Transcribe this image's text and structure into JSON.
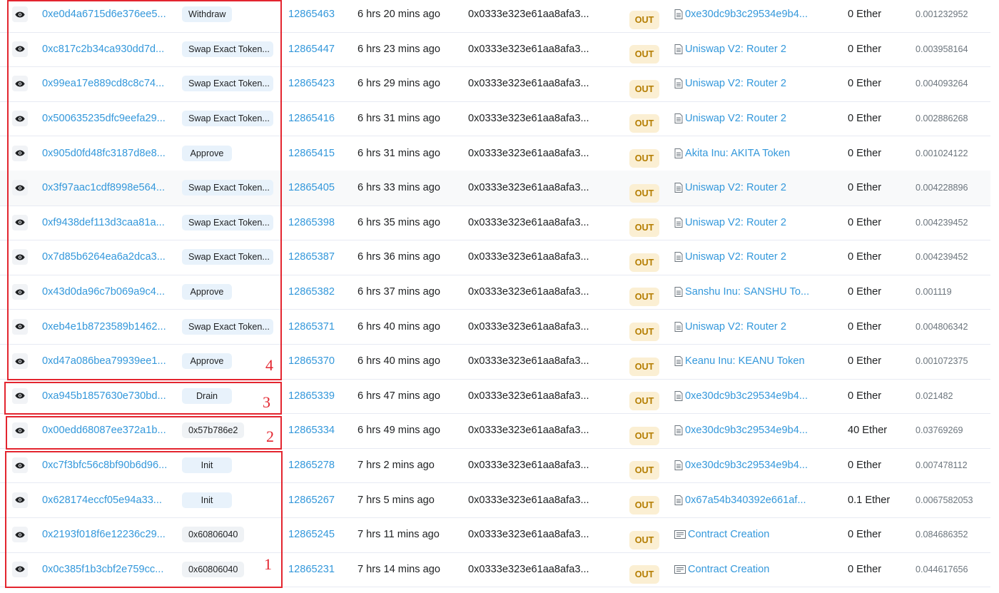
{
  "colors": {
    "link": "#3498db",
    "out_badge_bg": "#fbefd3",
    "out_badge_text": "#b47d00",
    "method_badge_bg": "#e8f2fb",
    "annotation": "#e3252f"
  },
  "icons": {
    "view": "eye-icon",
    "contract": "contract-file-icon",
    "creation": "contract-creation-icon"
  },
  "rows": [
    {
      "hash": "0xe0d4a6715d6e376ee5...",
      "method": "Withdraw",
      "block": "12865463",
      "age": "6 hrs 20 mins ago",
      "from": "0x0333e323e61aa8afa3...",
      "direction": "OUT",
      "to": "0xe30dc9b3c29534e9b4...",
      "value": "0 Ether",
      "fee": "0.001232952",
      "to_icon": "contract-file-icon"
    },
    {
      "hash": "0xc817c2b34ca930dd7d...",
      "method": "Swap Exact Token...",
      "block": "12865447",
      "age": "6 hrs 23 mins ago",
      "from": "0x0333e323e61aa8afa3...",
      "direction": "OUT",
      "to": "Uniswap V2: Router 2",
      "value": "0 Ether",
      "fee": "0.003958164",
      "to_icon": "contract-file-icon"
    },
    {
      "hash": "0x99ea17e889cd8c8c74...",
      "method": "Swap Exact Token...",
      "block": "12865423",
      "age": "6 hrs 29 mins ago",
      "from": "0x0333e323e61aa8afa3...",
      "direction": "OUT",
      "to": "Uniswap V2: Router 2",
      "value": "0 Ether",
      "fee": "0.004093264",
      "to_icon": "contract-file-icon"
    },
    {
      "hash": "0x500635235dfc9eefa29...",
      "method": "Swap Exact Token...",
      "block": "12865416",
      "age": "6 hrs 31 mins ago",
      "from": "0x0333e323e61aa8afa3...",
      "direction": "OUT",
      "to": "Uniswap V2: Router 2",
      "value": "0 Ether",
      "fee": "0.002886268",
      "to_icon": "contract-file-icon"
    },
    {
      "hash": "0x905d0fd48fc3187d8e8...",
      "method": "Approve",
      "block": "12865415",
      "age": "6 hrs 31 mins ago",
      "from": "0x0333e323e61aa8afa3...",
      "direction": "OUT",
      "to": "Akita Inu: AKITA Token",
      "value": "0 Ether",
      "fee": "0.001024122",
      "to_icon": "contract-file-icon"
    },
    {
      "hash": "0x3f97aac1cdf8998e564...",
      "method": "Swap Exact Token...",
      "block": "12865405",
      "age": "6 hrs 33 mins ago",
      "from": "0x0333e323e61aa8afa3...",
      "direction": "OUT",
      "to": "Uniswap V2: Router 2",
      "value": "0 Ether",
      "fee": "0.004228896",
      "to_icon": "contract-file-icon",
      "highlight": true
    },
    {
      "hash": "0xf9438def113d3caa81a...",
      "method": "Swap Exact Token...",
      "block": "12865398",
      "age": "6 hrs 35 mins ago",
      "from": "0x0333e323e61aa8afa3...",
      "direction": "OUT",
      "to": "Uniswap V2: Router 2",
      "value": "0 Ether",
      "fee": "0.004239452",
      "to_icon": "contract-file-icon"
    },
    {
      "hash": "0x7d85b6264ea6a2dca3...",
      "method": "Swap Exact Token...",
      "block": "12865387",
      "age": "6 hrs 36 mins ago",
      "from": "0x0333e323e61aa8afa3...",
      "direction": "OUT",
      "to": "Uniswap V2: Router 2",
      "value": "0 Ether",
      "fee": "0.004239452",
      "to_icon": "contract-file-icon"
    },
    {
      "hash": "0x43d0da96c7b069a9c4...",
      "method": "Approve",
      "block": "12865382",
      "age": "6 hrs 37 mins ago",
      "from": "0x0333e323e61aa8afa3...",
      "direction": "OUT",
      "to": "Sanshu Inu: SANSHU To...",
      "value": "0 Ether",
      "fee": "0.001119",
      "to_icon": "contract-file-icon"
    },
    {
      "hash": "0xeb4e1b8723589b1462...",
      "method": "Swap Exact Token...",
      "block": "12865371",
      "age": "6 hrs 40 mins ago",
      "from": "0x0333e323e61aa8afa3...",
      "direction": "OUT",
      "to": "Uniswap V2: Router 2",
      "value": "0 Ether",
      "fee": "0.004806342",
      "to_icon": "contract-file-icon"
    },
    {
      "hash": "0xd47a086bea79939ee1...",
      "method": "Approve",
      "block": "12865370",
      "age": "6 hrs 40 mins ago",
      "from": "0x0333e323e61aa8afa3...",
      "direction": "OUT",
      "to": "Keanu Inu: KEANU Token",
      "value": "0 Ether",
      "fee": "0.001072375",
      "to_icon": "contract-file-icon"
    },
    {
      "hash": "0xa945b1857630e730bd...",
      "method": "Drain",
      "block": "12865339",
      "age": "6 hrs 47 mins ago",
      "from": "0x0333e323e61aa8afa3...",
      "direction": "OUT",
      "to": "0xe30dc9b3c29534e9b4...",
      "value": "0 Ether",
      "fee": "0.021482",
      "to_icon": "contract-file-icon"
    },
    {
      "hash": "0x00edd68087ee372a1b...",
      "method": "0x57b786e2",
      "block": "12865334",
      "age": "6 hrs 49 mins ago",
      "from": "0x0333e323e61aa8afa3...",
      "direction": "OUT",
      "to": "0xe30dc9b3c29534e9b4...",
      "value": "40 Ether",
      "fee": "0.03769269",
      "to_icon": "contract-file-icon"
    },
    {
      "hash": "0xc7f3bfc56c8bf90b6d96...",
      "method": "Init",
      "block": "12865278",
      "age": "7 hrs 2 mins ago",
      "from": "0x0333e323e61aa8afa3...",
      "direction": "OUT",
      "to": "0xe30dc9b3c29534e9b4...",
      "value": "0 Ether",
      "fee": "0.007478112",
      "to_icon": "contract-file-icon"
    },
    {
      "hash": "0x628174eccf05e94a33...",
      "method": "Init",
      "block": "12865267",
      "age": "7 hrs 5 mins ago",
      "from": "0x0333e323e61aa8afa3...",
      "direction": "OUT",
      "to": "0x67a54b340392e661af...",
      "value": "0.1 Ether",
      "fee": "0.0067582053",
      "to_icon": "contract-file-icon"
    },
    {
      "hash": "0x2193f018f6e12236c29...",
      "method": "0x60806040",
      "block": "12865245",
      "age": "7 hrs 11 mins ago",
      "from": "0x0333e323e61aa8afa3...",
      "direction": "OUT",
      "to": "Contract Creation",
      "value": "0 Ether",
      "fee": "0.084686352",
      "to_icon": "contract-creation-icon"
    },
    {
      "hash": "0x0c385f1b3cbf2e759cc...",
      "method": "0x60806040",
      "block": "12865231",
      "age": "7 hrs 14 mins ago",
      "from": "0x0333e323e61aa8afa3...",
      "direction": "OUT",
      "to": "Contract Creation",
      "value": "0 Ether",
      "fee": "0.044617656",
      "to_icon": "contract-creation-icon"
    }
  ],
  "annotations": [
    {
      "label": "4",
      "first_row": 0,
      "last_row": 10
    },
    {
      "label": "3",
      "first_row": 11,
      "last_row": 11
    },
    {
      "label": "2",
      "first_row": 12,
      "last_row": 12
    },
    {
      "label": "1",
      "first_row": 13,
      "last_row": 16
    }
  ]
}
